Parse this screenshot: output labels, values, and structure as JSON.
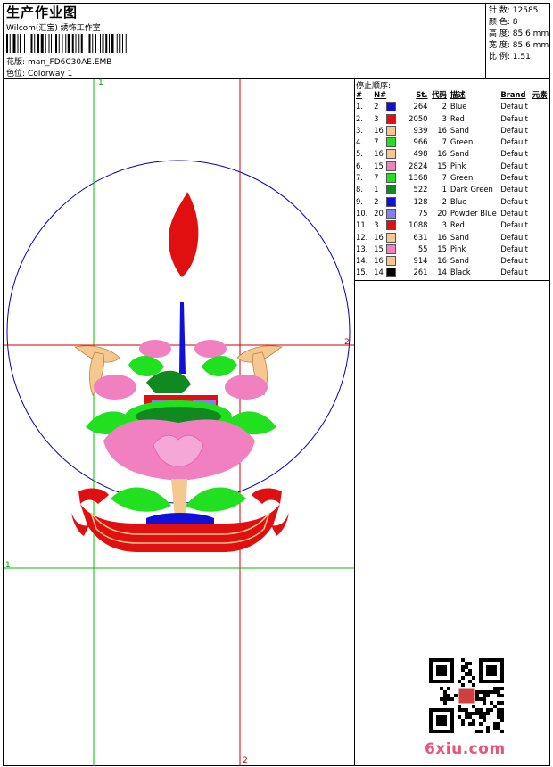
{
  "header": {
    "title": "生产作业图",
    "company": "Wilcom(汇宝) 绣饰工作室",
    "design_label": "花版:",
    "design_file": "man_FD6C30AE.EMB",
    "colorway_label": "色位:",
    "colorway": "Colorway 1"
  },
  "stats": [
    {
      "label": "针 数:",
      "value": "12585"
    },
    {
      "label": "颜 色:",
      "value": "8"
    },
    {
      "label": "高 度:",
      "value": "85.6 mm"
    },
    {
      "label": "宽 度:",
      "value": "85.6 mm"
    },
    {
      "label": "比 例:",
      "value": "1.51"
    }
  ],
  "stop_sequence": {
    "title": "停止顺序:",
    "columns": {
      "idx": "#",
      "needle": "N#",
      "stitches": "St.",
      "code": "代码",
      "desc": "描述",
      "brand": "Brand",
      "element": "元素"
    },
    "rows": [
      {
        "idx": "1.",
        "needle": "2",
        "color": "#1010d8",
        "stitches": "264",
        "code": "2",
        "desc": "Blue",
        "brand": "Default"
      },
      {
        "idx": "2.",
        "needle": "3",
        "color": "#e01010",
        "stitches": "2050",
        "code": "3",
        "desc": "Red",
        "brand": "Default"
      },
      {
        "idx": "3.",
        "needle": "16",
        "color": "#f5c890",
        "stitches": "939",
        "code": "16",
        "desc": "Sand",
        "brand": "Default"
      },
      {
        "idx": "4.",
        "needle": "7",
        "color": "#20e020",
        "stitches": "966",
        "code": "7",
        "desc": "Green",
        "brand": "Default"
      },
      {
        "idx": "5.",
        "needle": "16",
        "color": "#f5c890",
        "stitches": "498",
        "code": "16",
        "desc": "Sand",
        "brand": "Default"
      },
      {
        "idx": "6.",
        "needle": "15",
        "color": "#f080c0",
        "stitches": "2824",
        "code": "15",
        "desc": "Pink",
        "brand": "Default"
      },
      {
        "idx": "7.",
        "needle": "7",
        "color": "#20e020",
        "stitches": "1368",
        "code": "7",
        "desc": "Green",
        "brand": "Default"
      },
      {
        "idx": "8.",
        "needle": "1",
        "color": "#108a20",
        "stitches": "522",
        "code": "1",
        "desc": "Dark Green",
        "brand": "Default"
      },
      {
        "idx": "9.",
        "needle": "2",
        "color": "#1010d8",
        "stitches": "128",
        "code": "2",
        "desc": "Blue",
        "brand": "Default"
      },
      {
        "idx": "10.",
        "needle": "20",
        "color": "#8080f0",
        "stitches": "75",
        "code": "20",
        "desc": "Powder Blue",
        "brand": "Default"
      },
      {
        "idx": "11.",
        "needle": "3",
        "color": "#e01010",
        "stitches": "1088",
        "code": "3",
        "desc": "Red",
        "brand": "Default"
      },
      {
        "idx": "12.",
        "needle": "16",
        "color": "#f5c890",
        "stitches": "631",
        "code": "16",
        "desc": "Sand",
        "brand": "Default"
      },
      {
        "idx": "13.",
        "needle": "15",
        "color": "#f080c0",
        "stitches": "55",
        "code": "15",
        "desc": "Pink",
        "brand": "Default"
      },
      {
        "idx": "14.",
        "needle": "16",
        "color": "#f5c890",
        "stitches": "914",
        "code": "16",
        "desc": "Sand",
        "brand": "Default"
      },
      {
        "idx": "15.",
        "needle": "14",
        "color": "#000000",
        "stitches": "261",
        "code": "14",
        "desc": "Black",
        "brand": "Default"
      }
    ]
  },
  "guides": {
    "v1": "1",
    "v2": "2",
    "h1": "1",
    "h2": "2"
  },
  "watermark": "6xiu.com",
  "colors": {
    "guide_green": "#00c000",
    "guide_red": "#d00000",
    "hoop_blue": "#0000c0"
  }
}
